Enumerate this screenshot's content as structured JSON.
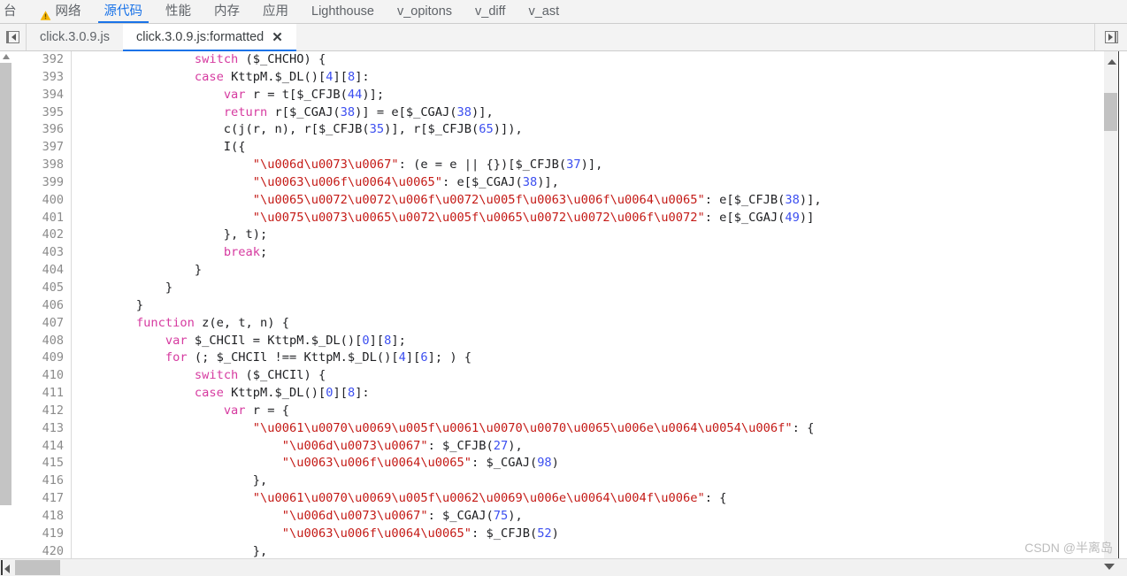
{
  "devtools_tabs": [
    {
      "label": "台",
      "icon": null,
      "active": false,
      "truncated": true
    },
    {
      "label": "网络",
      "icon": "warning-icon",
      "active": false
    },
    {
      "label": "源代码",
      "icon": null,
      "active": true
    },
    {
      "label": "性能",
      "icon": null,
      "active": false
    },
    {
      "label": "内存",
      "icon": null,
      "active": false
    },
    {
      "label": "应用",
      "icon": null,
      "active": false
    },
    {
      "label": "Lighthouse",
      "icon": null,
      "active": false
    },
    {
      "label": "v_opitons",
      "icon": null,
      "active": false
    },
    {
      "label": "v_diff",
      "icon": null,
      "active": false
    },
    {
      "label": "v_ast",
      "icon": null,
      "active": false
    }
  ],
  "file_tabs": {
    "left_panel_toggle": "show-navigator-icon",
    "right_panel_toggle": "show-debugger-icon",
    "tabs": [
      {
        "label": "click.3.0.9.js",
        "active": false,
        "closable": false
      },
      {
        "label": "click.3.0.9.js:formatted",
        "active": true,
        "closable": true,
        "close_label": "✕"
      }
    ]
  },
  "editor": {
    "first_line_number": 392,
    "lines": [
      {
        "n": 392,
        "tokens": [
          {
            "t": "                ",
            "c": "pln"
          },
          {
            "t": "switch",
            "c": "kw"
          },
          {
            "t": " ($_CHCHO) {",
            "c": "pln"
          }
        ]
      },
      {
        "n": 393,
        "tokens": [
          {
            "t": "                ",
            "c": "pln"
          },
          {
            "t": "case",
            "c": "kw"
          },
          {
            "t": " KttpM.$_DL()[",
            "c": "pln"
          },
          {
            "t": "4",
            "c": "num"
          },
          {
            "t": "][",
            "c": "pln"
          },
          {
            "t": "8",
            "c": "num"
          },
          {
            "t": "]:",
            "c": "pln"
          }
        ]
      },
      {
        "n": 394,
        "tokens": [
          {
            "t": "                    ",
            "c": "pln"
          },
          {
            "t": "var",
            "c": "kw"
          },
          {
            "t": " r = t[$_CFJB(",
            "c": "pln"
          },
          {
            "t": "44",
            "c": "num"
          },
          {
            "t": ")];",
            "c": "pln"
          }
        ]
      },
      {
        "n": 395,
        "tokens": [
          {
            "t": "                    ",
            "c": "pln"
          },
          {
            "t": "return",
            "c": "kw"
          },
          {
            "t": " r[$_CGAJ(",
            "c": "pln"
          },
          {
            "t": "38",
            "c": "num"
          },
          {
            "t": ")] = e[$_CGAJ(",
            "c": "pln"
          },
          {
            "t": "38",
            "c": "num"
          },
          {
            "t": ")],",
            "c": "pln"
          }
        ]
      },
      {
        "n": 396,
        "tokens": [
          {
            "t": "                    c(j(r, n), r[$_CFJB(",
            "c": "pln"
          },
          {
            "t": "35",
            "c": "num"
          },
          {
            "t": ")], r[$_CFJB(",
            "c": "pln"
          },
          {
            "t": "65",
            "c": "num"
          },
          {
            "t": ")]),",
            "c": "pln"
          }
        ]
      },
      {
        "n": 397,
        "tokens": [
          {
            "t": "                    I({",
            "c": "pln"
          }
        ]
      },
      {
        "n": 398,
        "tokens": [
          {
            "t": "                        ",
            "c": "pln"
          },
          {
            "t": "\"\\u006d\\u0073\\u0067\"",
            "c": "str"
          },
          {
            "t": ": (e = e || {})[$_CFJB(",
            "c": "pln"
          },
          {
            "t": "37",
            "c": "num"
          },
          {
            "t": ")],",
            "c": "pln"
          }
        ]
      },
      {
        "n": 399,
        "tokens": [
          {
            "t": "                        ",
            "c": "pln"
          },
          {
            "t": "\"\\u0063\\u006f\\u0064\\u0065\"",
            "c": "str"
          },
          {
            "t": ": e[$_CGAJ(",
            "c": "pln"
          },
          {
            "t": "38",
            "c": "num"
          },
          {
            "t": ")],",
            "c": "pln"
          }
        ]
      },
      {
        "n": 400,
        "tokens": [
          {
            "t": "                        ",
            "c": "pln"
          },
          {
            "t": "\"\\u0065\\u0072\\u0072\\u006f\\u0072\\u005f\\u0063\\u006f\\u0064\\u0065\"",
            "c": "str"
          },
          {
            "t": ": e[$_CFJB(",
            "c": "pln"
          },
          {
            "t": "38",
            "c": "num"
          },
          {
            "t": ")],",
            "c": "pln"
          }
        ]
      },
      {
        "n": 401,
        "tokens": [
          {
            "t": "                        ",
            "c": "pln"
          },
          {
            "t": "\"\\u0075\\u0073\\u0065\\u0072\\u005f\\u0065\\u0072\\u0072\\u006f\\u0072\"",
            "c": "str"
          },
          {
            "t": ": e[$_CGAJ(",
            "c": "pln"
          },
          {
            "t": "49",
            "c": "num"
          },
          {
            "t": ")]",
            "c": "pln"
          }
        ]
      },
      {
        "n": 402,
        "tokens": [
          {
            "t": "                    }, t);",
            "c": "pln"
          }
        ]
      },
      {
        "n": 403,
        "tokens": [
          {
            "t": "                    ",
            "c": "pln"
          },
          {
            "t": "break",
            "c": "kw"
          },
          {
            "t": ";",
            "c": "pln"
          }
        ]
      },
      {
        "n": 404,
        "tokens": [
          {
            "t": "                }",
            "c": "pln"
          }
        ]
      },
      {
        "n": 405,
        "tokens": [
          {
            "t": "            }",
            "c": "pln"
          }
        ]
      },
      {
        "n": 406,
        "tokens": [
          {
            "t": "        }",
            "c": "pln"
          }
        ]
      },
      {
        "n": 407,
        "tokens": [
          {
            "t": "        ",
            "c": "pln"
          },
          {
            "t": "function",
            "c": "kw"
          },
          {
            "t": " z(e, t, n) {",
            "c": "pln"
          }
        ]
      },
      {
        "n": 408,
        "tokens": [
          {
            "t": "            ",
            "c": "pln"
          },
          {
            "t": "var",
            "c": "kw"
          },
          {
            "t": " $_CHCIl = KttpM.$_DL()[",
            "c": "pln"
          },
          {
            "t": "0",
            "c": "num"
          },
          {
            "t": "][",
            "c": "pln"
          },
          {
            "t": "8",
            "c": "num"
          },
          {
            "t": "];",
            "c": "pln"
          }
        ]
      },
      {
        "n": 409,
        "tokens": [
          {
            "t": "            ",
            "c": "pln"
          },
          {
            "t": "for",
            "c": "kw"
          },
          {
            "t": " (; $_CHCIl !== KttpM.$_DL()[",
            "c": "pln"
          },
          {
            "t": "4",
            "c": "num"
          },
          {
            "t": "][",
            "c": "pln"
          },
          {
            "t": "6",
            "c": "num"
          },
          {
            "t": "]; ) {",
            "c": "pln"
          }
        ]
      },
      {
        "n": 410,
        "tokens": [
          {
            "t": "                ",
            "c": "pln"
          },
          {
            "t": "switch",
            "c": "kw"
          },
          {
            "t": " ($_CHCIl) {",
            "c": "pln"
          }
        ]
      },
      {
        "n": 411,
        "tokens": [
          {
            "t": "                ",
            "c": "pln"
          },
          {
            "t": "case",
            "c": "kw"
          },
          {
            "t": " KttpM.$_DL()[",
            "c": "pln"
          },
          {
            "t": "0",
            "c": "num"
          },
          {
            "t": "][",
            "c": "pln"
          },
          {
            "t": "8",
            "c": "num"
          },
          {
            "t": "]:",
            "c": "pln"
          }
        ]
      },
      {
        "n": 412,
        "tokens": [
          {
            "t": "                    ",
            "c": "pln"
          },
          {
            "t": "var",
            "c": "kw"
          },
          {
            "t": " r = {",
            "c": "pln"
          }
        ]
      },
      {
        "n": 413,
        "tokens": [
          {
            "t": "                        ",
            "c": "pln"
          },
          {
            "t": "\"\\u0061\\u0070\\u0069\\u005f\\u0061\\u0070\\u0070\\u0065\\u006e\\u0064\\u0054\\u006f\"",
            "c": "str"
          },
          {
            "t": ": {",
            "c": "pln"
          }
        ]
      },
      {
        "n": 414,
        "tokens": [
          {
            "t": "                            ",
            "c": "pln"
          },
          {
            "t": "\"\\u006d\\u0073\\u0067\"",
            "c": "str"
          },
          {
            "t": ": $_CFJB(",
            "c": "pln"
          },
          {
            "t": "27",
            "c": "num"
          },
          {
            "t": "),",
            "c": "pln"
          }
        ]
      },
      {
        "n": 415,
        "tokens": [
          {
            "t": "                            ",
            "c": "pln"
          },
          {
            "t": "\"\\u0063\\u006f\\u0064\\u0065\"",
            "c": "str"
          },
          {
            "t": ": $_CGAJ(",
            "c": "pln"
          },
          {
            "t": "98",
            "c": "num"
          },
          {
            "t": ")",
            "c": "pln"
          }
        ]
      },
      {
        "n": 416,
        "tokens": [
          {
            "t": "                        },",
            "c": "pln"
          }
        ]
      },
      {
        "n": 417,
        "tokens": [
          {
            "t": "                        ",
            "c": "pln"
          },
          {
            "t": "\"\\u0061\\u0070\\u0069\\u005f\\u0062\\u0069\\u006e\\u0064\\u004f\\u006e\"",
            "c": "str"
          },
          {
            "t": ": {",
            "c": "pln"
          }
        ]
      },
      {
        "n": 418,
        "tokens": [
          {
            "t": "                            ",
            "c": "pln"
          },
          {
            "t": "\"\\u006d\\u0073\\u0067\"",
            "c": "str"
          },
          {
            "t": ": $_CGAJ(",
            "c": "pln"
          },
          {
            "t": "75",
            "c": "num"
          },
          {
            "t": "),",
            "c": "pln"
          }
        ]
      },
      {
        "n": 419,
        "tokens": [
          {
            "t": "                            ",
            "c": "pln"
          },
          {
            "t": "\"\\u0063\\u006f\\u0064\\u0065\"",
            "c": "str"
          },
          {
            "t": ": $_CFJB(",
            "c": "pln"
          },
          {
            "t": "52",
            "c": "num"
          },
          {
            "t": ")",
            "c": "pln"
          }
        ]
      },
      {
        "n": 420,
        "tokens": [
          {
            "t": "                        },",
            "c": "pln"
          }
        ]
      }
    ]
  },
  "scrollbars": {
    "left_vertical": "left-vertical-scrollbar",
    "right_vertical": "right-vertical-scrollbar",
    "bottom_horizontal": "horizontal-scrollbar"
  },
  "watermark": "CSDN @半离岛",
  "colors": {
    "accent": "#1a73e8",
    "keyword": "#d63ba0",
    "number": "#3b4ef0",
    "string": "#c41a16",
    "text": "#202124",
    "gutter": "#8b8b8b",
    "toolbar_bg": "#f3f3f3",
    "warning": "#f5b400"
  }
}
